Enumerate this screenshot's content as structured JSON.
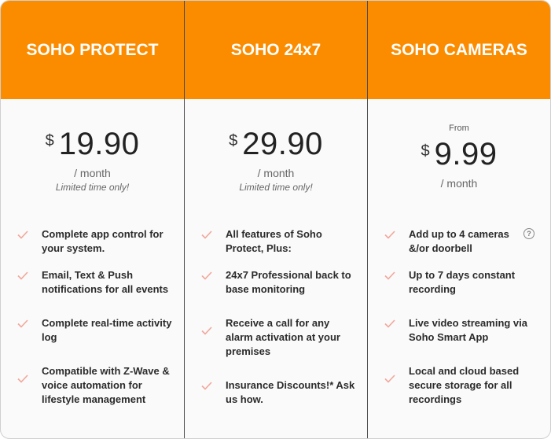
{
  "plans": [
    {
      "title": "SOHO PROTECT",
      "from": "",
      "currency": "$",
      "amount": "19.90",
      "period": "/  month",
      "note": "Limited time only!",
      "features": [
        "Complete app control for your system.",
        "Email, Text & Push notifications for all events",
        "Complete real-time activity log",
        "Compatible with Z-Wave & voice automation for lifestyle management"
      ]
    },
    {
      "title": "SOHO 24x7",
      "from": "",
      "currency": "$",
      "amount": "29.90",
      "period": "/  month",
      "note": "Limited time only!",
      "features": [
        "All features of Soho Protect, Plus:",
        "24x7 Professional back to base monitoring",
        "Receive a call for any alarm activation at your premises",
        "Insurance Discounts!* Ask us how."
      ]
    },
    {
      "title": "SOHO CAMERAS",
      "from": "From",
      "currency": "$",
      "amount": "9.99",
      "period": "/  month",
      "note": "",
      "features": [
        "Add up to 4 cameras &/or doorbell",
        "Up to 7 days constant recording",
        "Live video streaming via Soho Smart App",
        "Local and cloud based secure storage for all recordings"
      ],
      "help_icon": "question-circle-icon"
    }
  ],
  "colors": {
    "header_bg": "#fb8c00",
    "check": "#f2a69a"
  }
}
